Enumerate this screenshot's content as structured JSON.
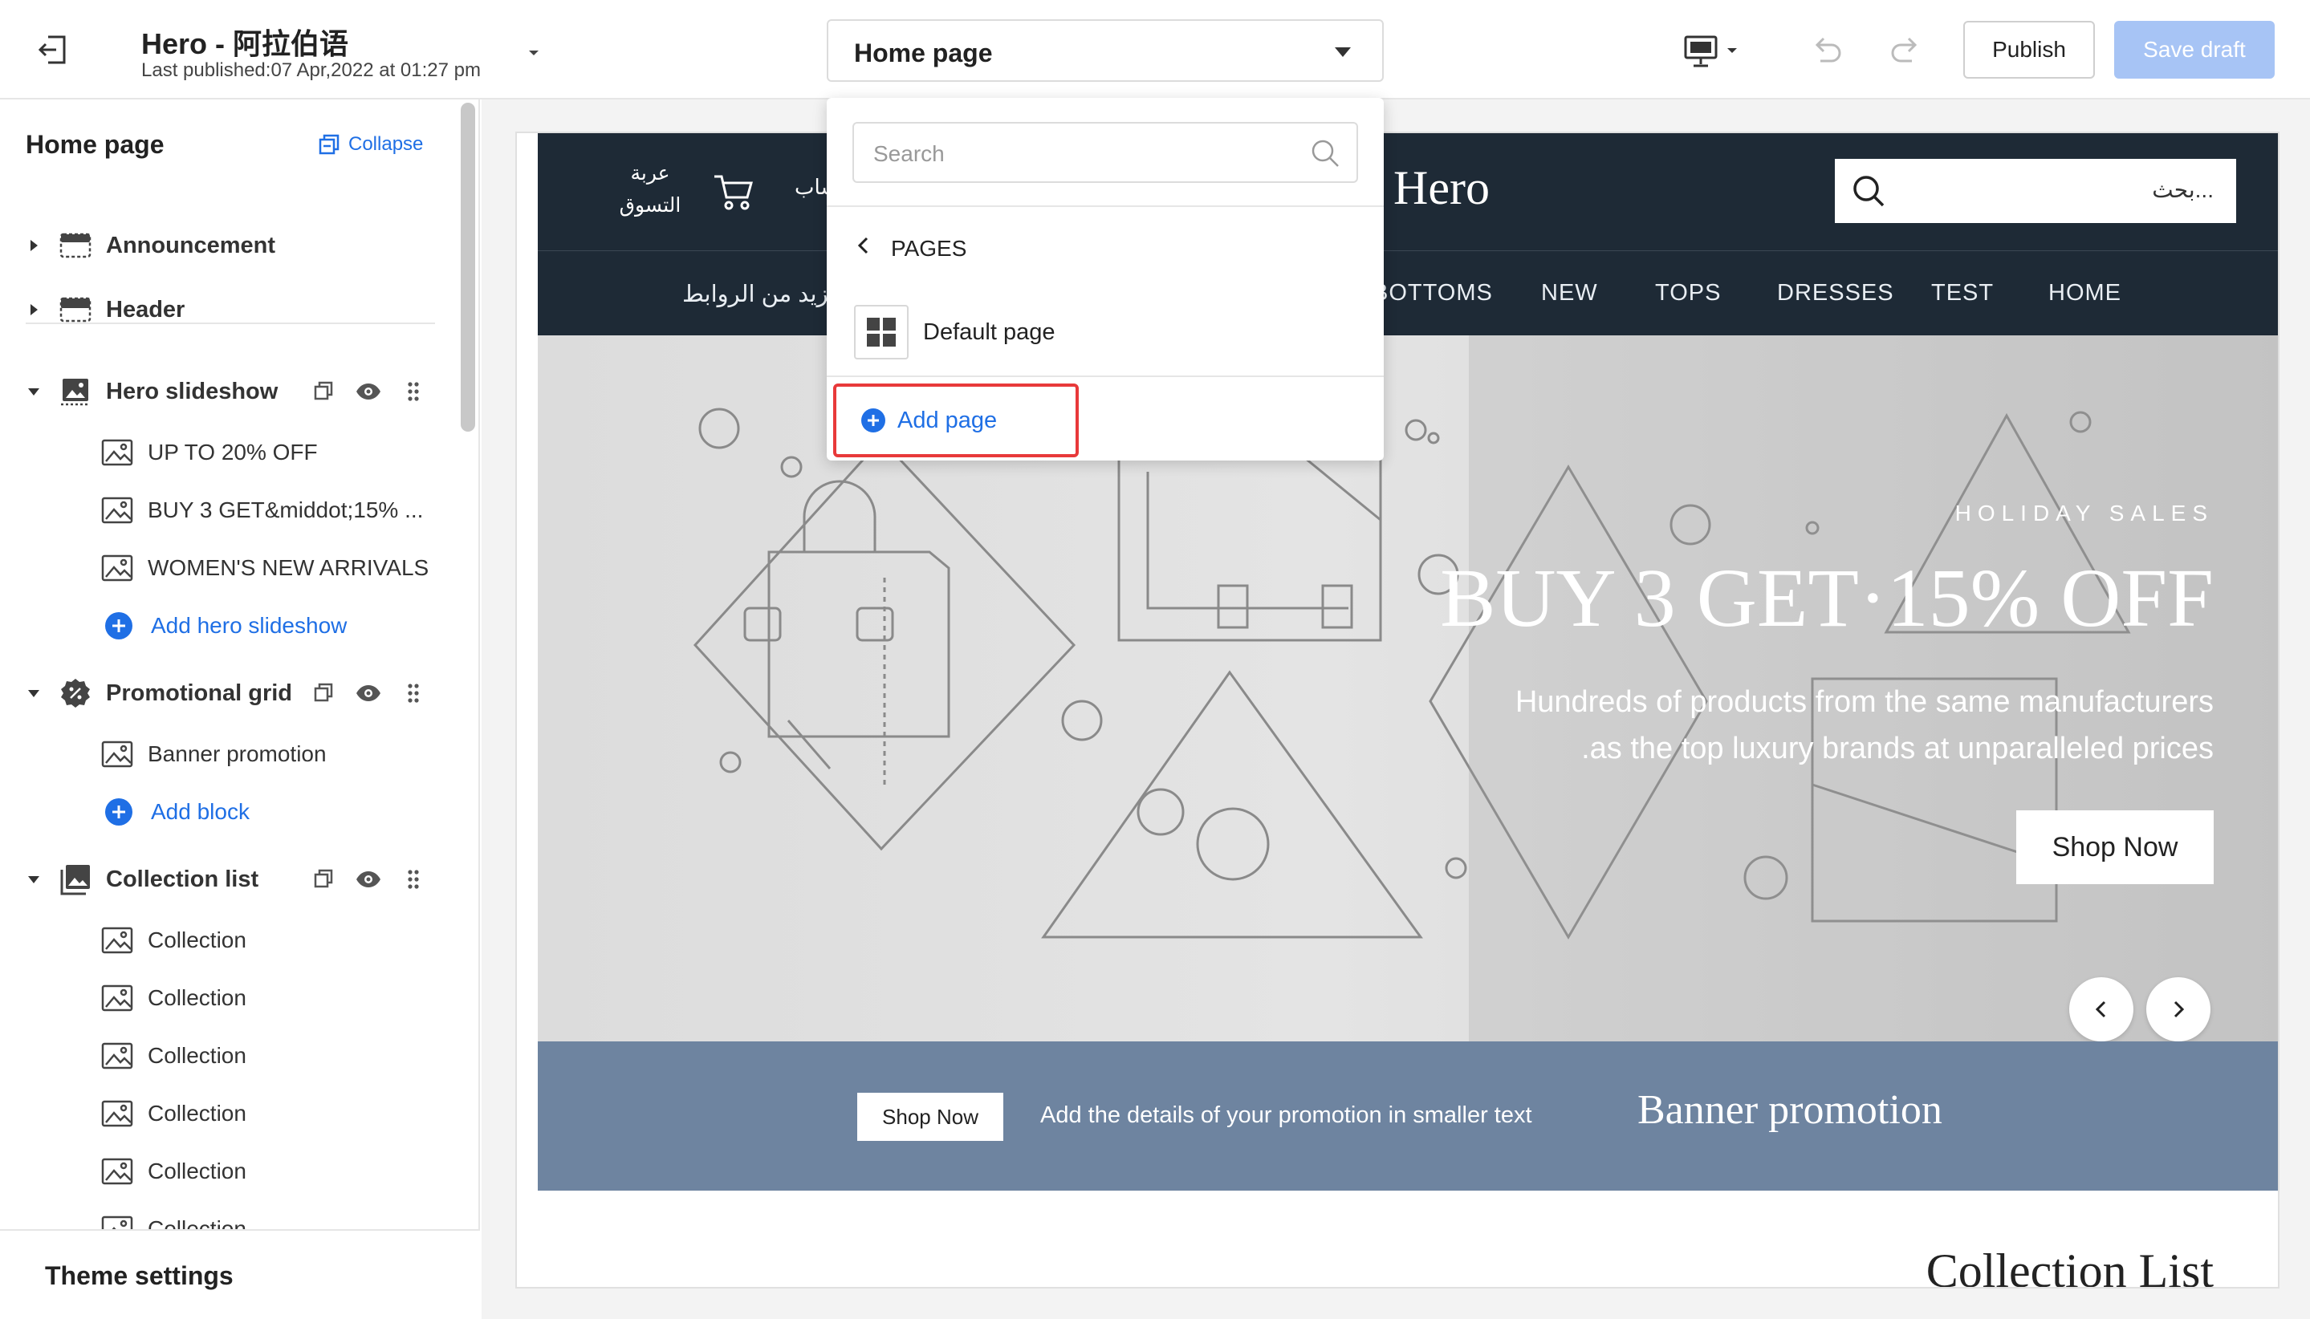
{
  "topbar": {
    "site_title": "Hero - 阿拉伯语",
    "last_published": "Last published:07 Apr,2022 at 01:27 pm",
    "page_select": "Home page",
    "publish": "Publish",
    "save_draft": "Save draft"
  },
  "sidebar": {
    "title": "Home page",
    "collapse": "Collapse",
    "sections": {
      "announcement": "Announcement",
      "header": "Header",
      "hero_slideshow": "Hero slideshow",
      "promotional_grid": "Promotional grid",
      "collection_list": "Collection list"
    },
    "hero_blocks": [
      "UP TO 20% OFF",
      "BUY 3 GET&middot;15% ...",
      "WOMEN'S NEW ARRIVALS"
    ],
    "add_hero": "Add hero slideshow",
    "promo_blocks": [
      "Banner promotion"
    ],
    "add_block": "Add block",
    "collection_blocks": [
      "Collection",
      "Collection",
      "Collection",
      "Collection",
      "Collection",
      "Collection"
    ],
    "theme_settings": "Theme settings"
  },
  "dropdown": {
    "search_placeholder": "Search",
    "section_label": "PAGES",
    "default_page": "Default page",
    "add_page": "Add page"
  },
  "preview": {
    "cart_label": "عربة التسوق",
    "account_label": "حساب",
    "logo": "Hero",
    "search_placeholder": "بحث...",
    "more_links": "المزيد من الروابط",
    "nav_items": [
      "BOTTOMS",
      "NEW",
      "TOPS",
      "DRESSES",
      "TEST",
      "HOME"
    ],
    "hero": {
      "kicker": "HOLIDAY SALES",
      "title": "BUY 3 GET·15% OFF",
      "line1": "Hundreds of products from the same manufacturers",
      "line2": ".as the top luxury brands at unparalleled prices",
      "button": "Shop Now"
    },
    "banner": {
      "button": "Shop Now",
      "details": "Add the details of your promotion in smaller text",
      "title": "Banner promotion"
    },
    "collection_heading": "Collection List"
  },
  "colors": {
    "accent": "#1f6fe5",
    "save_disabled": "#a7c4f5",
    "header_bg": "#1e2a36",
    "banner_bg": "#6e84a0",
    "highlight": "#e8393a"
  }
}
